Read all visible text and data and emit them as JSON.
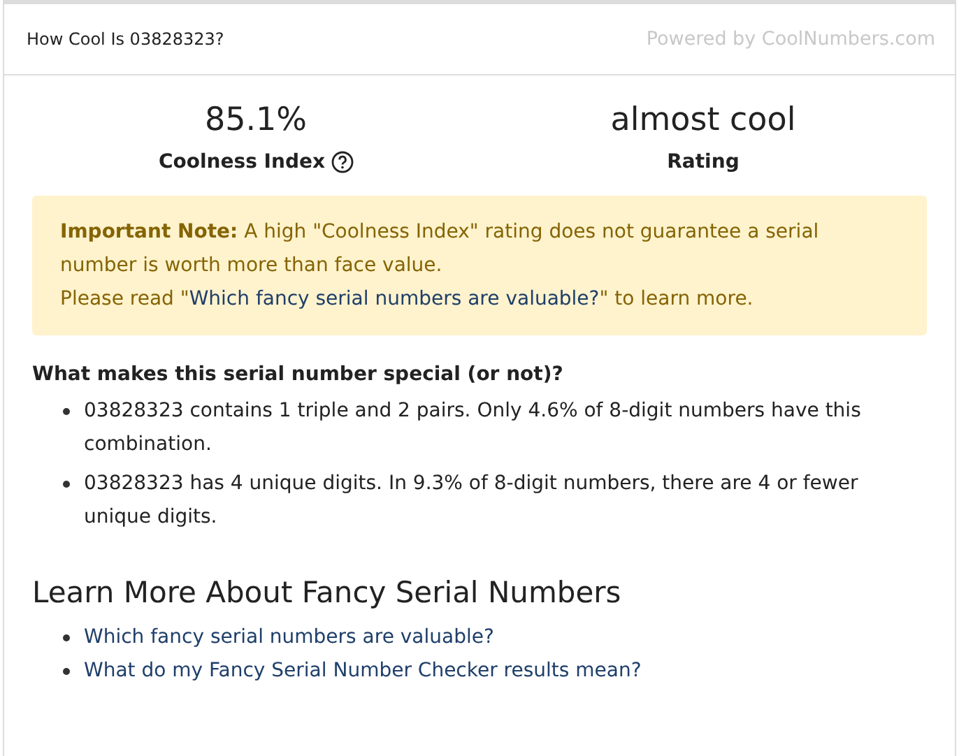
{
  "header": {
    "title": "How Cool Is 03828323?",
    "powered_by": "Powered by CoolNumbers.com"
  },
  "stats": [
    {
      "value": "85.1%",
      "label": "Coolness Index",
      "help": true
    },
    {
      "value": "almost cool",
      "label": "Rating",
      "help": false
    }
  ],
  "note": {
    "label": "Important Note:",
    "text": "A high \"Coolness Index\" rating does not guarantee a serial number is worth more than face value.",
    "line2_before": "Please read \"",
    "line2_link": "Which fancy serial numbers are valuable?",
    "line2_after": "\" to learn more."
  },
  "special": {
    "heading": "What makes this serial number special (or not)?",
    "items": [
      "03828323 contains 1 triple and 2 pairs. Only 4.6% of 8-digit numbers have this combination.",
      "03828323 has 4 unique digits. In 9.3% of 8-digit numbers, there are 4 or fewer unique digits."
    ]
  },
  "learn_more": {
    "heading": "Learn More About Fancy Serial Numbers",
    "links": [
      "Which fancy serial numbers are valuable?",
      "What do my Fancy Serial Number Checker results mean?"
    ]
  }
}
